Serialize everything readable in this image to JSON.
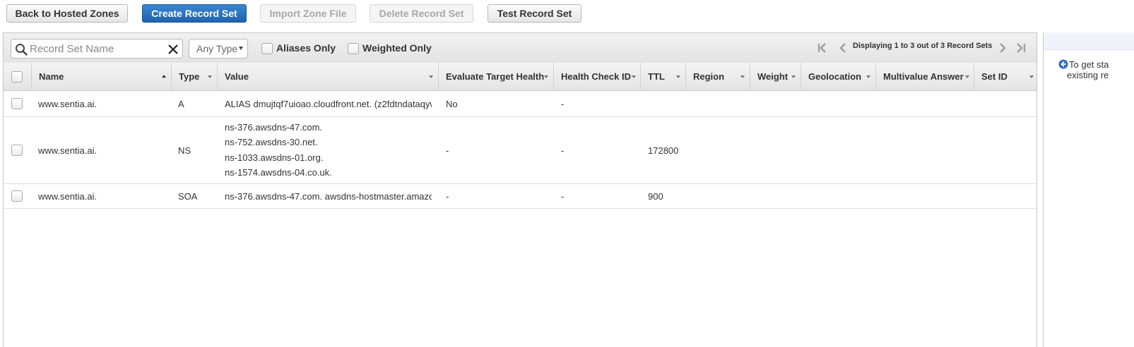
{
  "toolbar": {
    "back_label": "Back to Hosted Zones",
    "create_label": "Create Record Set",
    "import_label": "Import Zone File",
    "delete_label": "Delete Record Set",
    "test_label": "Test Record Set"
  },
  "filter": {
    "search_placeholder": "Record Set Name",
    "type_select": "Any Type",
    "aliases_only": "Aliases Only",
    "weighted_only": "Weighted Only",
    "pager_text": "Displaying 1 to 3 out of 3 Record Sets"
  },
  "columns": {
    "name": "Name",
    "type": "Type",
    "value": "Value",
    "evaluate": "Evaluate Target Health",
    "health": "Health Check ID",
    "ttl": "TTL",
    "region": "Region",
    "weight": "Weight",
    "geo": "Geolocation",
    "multivalue": "Multivalue Answer",
    "setid": "Set ID"
  },
  "records": [
    {
      "name": "www.sentia.ai.",
      "type": "A",
      "value": [
        "ALIAS dmujtqf7uioao.cloudfront.net. (z2fdtndataqyw"
      ],
      "evaluate": "No",
      "health": "-",
      "ttl": ""
    },
    {
      "name": "www.sentia.ai.",
      "type": "NS",
      "value": [
        "ns-376.awsdns-47.com.",
        "ns-752.awsdns-30.net.",
        "ns-1033.awsdns-01.org.",
        "ns-1574.awsdns-04.co.uk."
      ],
      "evaluate": "-",
      "health": "-",
      "ttl": "172800"
    },
    {
      "name": "www.sentia.ai.",
      "type": "SOA",
      "value": [
        "ns-376.awsdns-47.com. awsdns-hostmaster.amazor"
      ],
      "evaluate": "-",
      "health": "-",
      "ttl": "900"
    }
  ],
  "side": {
    "tip_line1": "To get sta",
    "tip_line2": "existing re"
  },
  "colors": {
    "primary": "#1f63ad",
    "info": "#2a6ebf"
  }
}
